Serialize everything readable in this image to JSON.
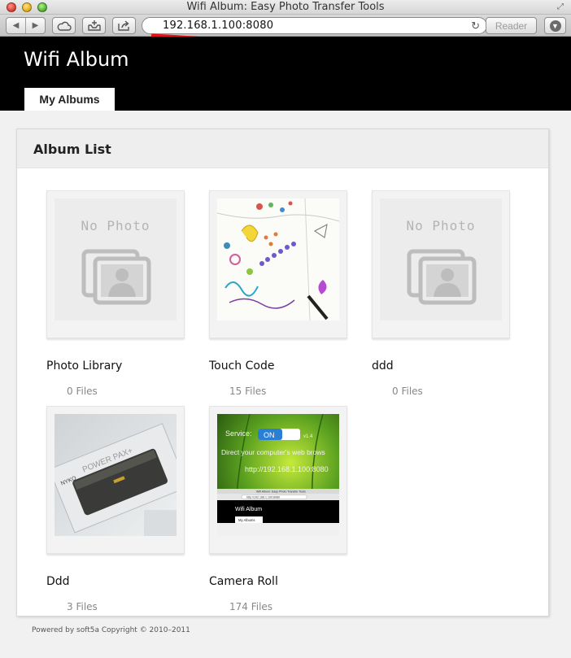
{
  "window": {
    "title": "Wifi Album: Easy Photo Transfer Tools"
  },
  "toolbar": {
    "url": "192.168.1.100:8080",
    "reader_label": "Reader"
  },
  "header": {
    "site_title": "Wifi Album",
    "tab_label": "My Albums"
  },
  "panel": {
    "title": "Album List"
  },
  "albums": [
    {
      "name": "Photo Library",
      "count": "0 Files",
      "thumb": "no-photo"
    },
    {
      "name": "Touch Code",
      "count": "15 Files",
      "thumb": "drawing"
    },
    {
      "name": "ddd",
      "count": "0 Files",
      "thumb": "no-photo"
    },
    {
      "name": "Ddd",
      "count": "3 Files",
      "thumb": "photo-powerpax"
    },
    {
      "name": "Camera Roll",
      "count": "174 Files",
      "thumb": "screenshot-app"
    }
  ],
  "thumbnails": {
    "no_photo_label": "No Photo",
    "powerpax": {
      "brand": "NYKO",
      "text": "POWER PAX+"
    },
    "camera_roll": {
      "service_label": "Service:",
      "toggle_label": "ON",
      "version": "v1.4",
      "instruction": "Direct your computer's web brows",
      "url": "http://192.168.1.100:8080",
      "mini_title": "Wifi Album: Easy Photo Transfer Tools",
      "mini_url": "http://192.168.1.100:8080",
      "mini_site_title": "Wifi Album",
      "mini_tab": "My Albums"
    }
  },
  "footer": {
    "text": "Powered by soft5a   Copyright © 2010–2011"
  },
  "colors": {
    "header_bg": "#000000",
    "panel_header_bg": "#eeeeee",
    "underline": "#e3121b"
  }
}
